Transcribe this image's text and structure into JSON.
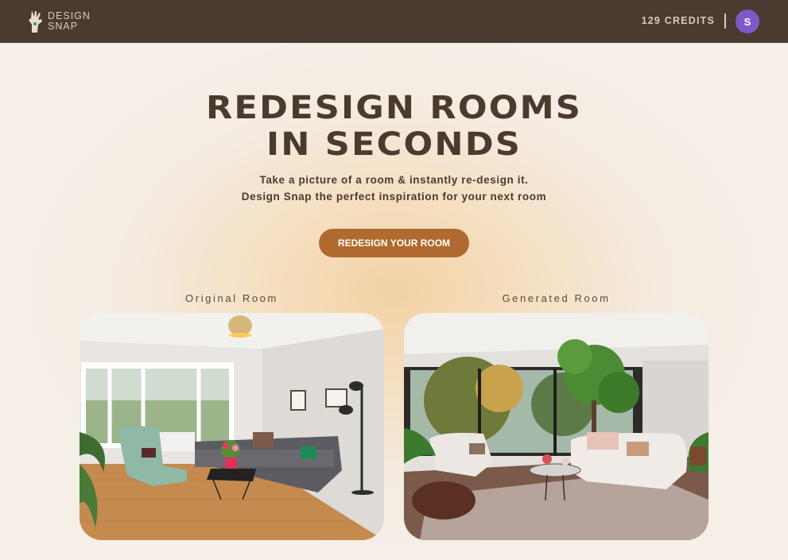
{
  "app": {
    "logo_line1": "DESIGN",
    "logo_line2": "SNAP",
    "credits": "129 CREDITS",
    "avatar_initial": "S"
  },
  "hero": {
    "title_line1": "REDESIGN ROOMS",
    "title_line2": "IN SECONDS",
    "subtitle_line1": "Take a picture of a room & instantly re-design it.",
    "subtitle_line2": "Design Snap the perfect inspiration for your next room",
    "cta_label": "REDESIGN YOUR ROOM"
  },
  "comparison": {
    "original_label": "Original Room",
    "generated_label": "Generated Room"
  },
  "colors": {
    "topbar": "#4a3a2f",
    "accent": "#b0692e",
    "avatar": "#7e58c7"
  }
}
